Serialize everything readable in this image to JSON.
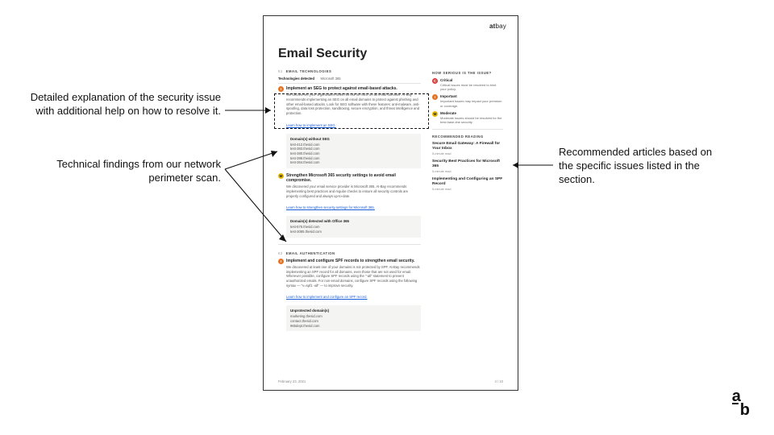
{
  "brand": {
    "at": "at",
    "bay": "bay"
  },
  "page": {
    "title": "Email Security",
    "date": "February 23, 2021",
    "pageNum": "4 / 10"
  },
  "annotations": {
    "explain": "Detailed explanation of the security issue with additional help on how to resolve it.",
    "findings": "Technical findings from our network perimeter scan.",
    "reading": "Recommended articles based on the specific issues listed in the section."
  },
  "severity": {
    "heading": "HOW SERIOUS IS THE ISSUE?",
    "levels": [
      {
        "letter": "C",
        "class": "critical",
        "name": "Critical",
        "desc": "Critical issues must be resolved to bind your policy."
      },
      {
        "letter": "I",
        "class": "important",
        "name": "Important",
        "desc": "Important issues may impact your premium or coverage."
      },
      {
        "letter": "M",
        "class": "moderate",
        "name": "Moderate",
        "desc": "Moderate issues should be resolved for the best base-line security."
      }
    ]
  },
  "recommended": {
    "heading": "RECOMMENDED READING",
    "items": [
      {
        "title": "Secure Email Gateway: A Firewall for Your Inbox",
        "meta": "5-minute read"
      },
      {
        "title": "Security Best Practices for Microsoft 365",
        "meta": "5-minute read"
      },
      {
        "title": "Implementing and Configuring an SPF Record",
        "meta": "5-minute read"
      }
    ]
  },
  "sections": [
    {
      "num": "01",
      "label": "EMAIL TECHNOLOGIES",
      "techLabel": "Technologies detected",
      "techValue": "Microsoft 365",
      "issues": [
        {
          "sev": "important",
          "letter": "I",
          "title": "Implement an SEG to protect against email-based attacks.",
          "body": "We discovered your organization does not use an SEG on all email domains. At-Bay recommends implementing an SEG on all email domains to protect against phishing and other email-based attacks. Look for SEG software with these features: anti-malware, anti-spoofing, data loss protection, sandboxing, secure encryption, and threat intelligence and protection.",
          "link": "Learn how to implement an SEG.",
          "findingsTitle": "Domain(s) without SEG",
          "findings": [
            "test-412.thesid.com",
            "test-383.thesid.com",
            "test-380.thesid.com",
            "test-398.thesid.com",
            "test-364.thesid.com"
          ]
        },
        {
          "sev": "moderate",
          "letter": "M",
          "title": "Strengthen Microsoft 365 security settings to avoid email compromise.",
          "body": "We discovered your email service provider is Microsoft 365. At-Bay recommends implementing best practices and regular checks to ensure all security controls are properly configured and always up-to-date.",
          "link": "Learn how to strengthen security settings for Microsoft 365.",
          "findingsTitle": "Domain(s) detected with Office 365",
          "findings": [
            "test-576.thesid.com",
            "test-3085.thesid.com"
          ]
        }
      ]
    },
    {
      "num": "02",
      "label": "EMAIL AUTHENTICATION",
      "issues": [
        {
          "sev": "important",
          "letter": "I",
          "title": "Implement and configure SPF records to strengthen email security.",
          "body": "We discovered at least one of your domains is not protected by SPF. At-Bay recommends implementing an SPF record for all domains, even those that are not used for email. Wherever possible, configure SPF records using the \"-all\" statement to prevent unauthorized emails. For non-email domains, configure SPF records using the following syntax — \"v=spf1 -all\" — to improve security.",
          "link": "Learn how to implement and configure an SPF record.",
          "findingsTitle": "Unprotected domain(s)",
          "findings": [
            "marketing.thesid.com",
            "contact.thesid.com",
            "965dept.thesid.com"
          ]
        }
      ]
    }
  ],
  "corner": {
    "top": "a",
    "sub": "b"
  }
}
